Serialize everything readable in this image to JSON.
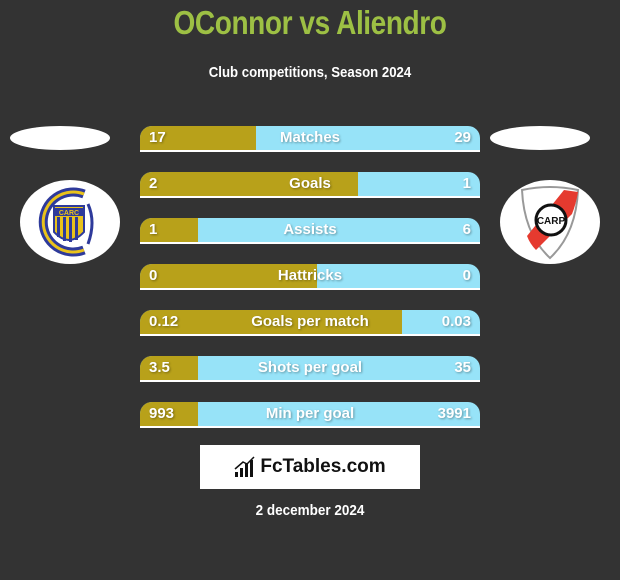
{
  "header": {
    "title": "OConnor vs Aliendro",
    "subtitle": "Club competitions, Season 2024"
  },
  "teams": {
    "left": {
      "logo": "rosario-central-crest-icon",
      "crest_text": "CARC"
    },
    "right": {
      "logo": "river-plate-crest-icon",
      "crest_text": "CARP"
    }
  },
  "colors": {
    "background": "#333333",
    "title": "#9dc044",
    "left_bar": "#b8a11a",
    "right_bar": "#97e3f8"
  },
  "chart_data": {
    "type": "bar",
    "title": "OConnor vs Aliendro",
    "subtitle": "Club competitions, Season 2024",
    "orientation": "horizontal-comparison",
    "series": [
      {
        "name": "OConnor",
        "values": [
          17,
          2,
          1,
          0,
          0.12,
          3.5,
          993
        ]
      },
      {
        "name": "Aliendro",
        "values": [
          29,
          1,
          6,
          0,
          0.03,
          35,
          3991
        ]
      }
    ],
    "categories": [
      "Matches",
      "Goals",
      "Assists",
      "Hattricks",
      "Goals per match",
      "Shots per goal",
      "Min per goal"
    ],
    "rows": [
      {
        "label": "Matches",
        "left": "17",
        "right": "29",
        "left_share": 0.34
      },
      {
        "label": "Goals",
        "left": "2",
        "right": "1",
        "left_share": 0.64
      },
      {
        "label": "Assists",
        "left": "1",
        "right": "6",
        "left_share": 0.17
      },
      {
        "label": "Hattricks",
        "left": "0",
        "right": "0",
        "left_share": 0.52
      },
      {
        "label": "Goals per match",
        "left": "0.12",
        "right": "0.03",
        "left_share": 0.77
      },
      {
        "label": "Shots per goal",
        "left": "3.5",
        "right": "35",
        "left_share": 0.17
      },
      {
        "label": "Min per goal",
        "left": "993",
        "right": "3991",
        "left_share": 0.17
      }
    ]
  },
  "footer": {
    "brand": "FcTables.com",
    "brand_icon": "bar-chart-icon",
    "date": "2 december 2024"
  }
}
